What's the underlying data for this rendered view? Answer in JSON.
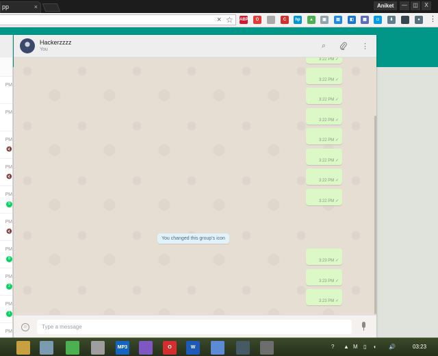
{
  "browser": {
    "tab_title": "pp",
    "tab_close": "×",
    "user_name": "Aniket",
    "window_controls": [
      "—",
      "◫",
      "X"
    ],
    "omnibox_clear": "×",
    "omnibox_star": "☆",
    "extensions": [
      {
        "name": "adblock-plus-icon",
        "label": "ABP",
        "color": "#d8152b"
      },
      {
        "name": "opera-icon",
        "label": "O",
        "color": "#e53935"
      },
      {
        "name": "grey-circle-extension-icon",
        "label": "",
        "color": "#aaaaaa"
      },
      {
        "name": "c-extension-icon",
        "label": "C",
        "color": "#d32f2f"
      },
      {
        "name": "hp-icon",
        "label": "hp",
        "color": "#0096d6"
      },
      {
        "name": "drive-icon",
        "label": "▲",
        "color": "#4caf50"
      },
      {
        "name": "image-extension-icon",
        "label": "▣",
        "color": "#90a4ae"
      },
      {
        "name": "screen-extension-icon",
        "label": "▤",
        "color": "#1e88e5"
      },
      {
        "name": "blue-tile-extension-icon",
        "label": "◧",
        "color": "#1976d2"
      },
      {
        "name": "grid-extension-icon",
        "label": "▦",
        "color": "#5c6bc0"
      },
      {
        "name": "pocket-icon",
        "label": "◘",
        "color": "#039be5"
      },
      {
        "name": "download-extension-icon",
        "label": "⬇",
        "color": "#607d8b"
      },
      {
        "name": "dark-extension-icon",
        "label": "",
        "color": "#37474f"
      },
      {
        "name": "profile-extension-icon",
        "label": "●",
        "color": "#546e7a"
      },
      {
        "name": "pinterest-icon",
        "label": "P",
        "color": "#e60023"
      }
    ],
    "menu": "⋮"
  },
  "chat_list": {
    "rows": [
      {
        "time": "PM",
        "badge": "",
        "muted": false
      },
      {
        "time": "PM",
        "badge": "",
        "muted": false
      },
      {
        "time": "PM",
        "badge": "",
        "muted": true
      },
      {
        "time": "PM",
        "badge": "",
        "muted": true
      },
      {
        "time": "PM",
        "badge": "9",
        "muted": false
      },
      {
        "time": "PM",
        "badge": "",
        "muted": true
      },
      {
        "time": "PM",
        "badge": "8",
        "muted": false
      },
      {
        "time": "PM",
        "badge": "2",
        "muted": false
      },
      {
        "time": "PM",
        "badge": "1",
        "muted": false
      },
      {
        "time": "PM",
        "badge": "",
        "muted": false
      }
    ]
  },
  "chat": {
    "name": "Hackerzzzz",
    "subtitle": "You",
    "icons": {
      "search": "⌕",
      "attach": "📎",
      "menu": "⋮"
    },
    "messages_top": [
      {
        "time": "3:22 PM",
        "tick": "✓"
      },
      {
        "time": "3:22 PM",
        "tick": "✓"
      },
      {
        "time": "3:22 PM",
        "tick": "✓"
      },
      {
        "time": "3:22 PM",
        "tick": "✓"
      },
      {
        "time": "3:22 PM",
        "tick": "✓"
      },
      {
        "time": "3:22 PM",
        "tick": "✓"
      },
      {
        "time": "3:22 PM",
        "tick": "✓"
      },
      {
        "time": "3:22 PM",
        "tick": "✓"
      }
    ],
    "system_message": "You changed this group's icon",
    "messages_bottom": [
      {
        "time": "3:23 PM",
        "tick": "✓"
      },
      {
        "time": "3:23 PM",
        "tick": "✓"
      },
      {
        "time": "3:23 PM",
        "tick": "✓"
      }
    ],
    "composer": {
      "placeholder": "Type a message",
      "emoji": "☺"
    }
  },
  "taskbar": {
    "apps": [
      {
        "name": "taskbar-app-1",
        "label": "",
        "color": "#c8a040"
      },
      {
        "name": "taskbar-app-2",
        "label": "",
        "color": "#7a9bb0"
      },
      {
        "name": "taskbar-app-3",
        "label": "",
        "color": "#4caf50"
      },
      {
        "name": "taskbar-app-4",
        "label": "",
        "color": "#9e9e9e"
      },
      {
        "name": "taskbar-app-5",
        "label": "MP3",
        "color": "#1565c0"
      },
      {
        "name": "taskbar-app-6",
        "label": "",
        "color": "#7e57c2"
      },
      {
        "name": "taskbar-app-7",
        "label": "O",
        "color": "#d32f2f"
      },
      {
        "name": "taskbar-app-8",
        "label": "W",
        "color": "#1e5bb8"
      },
      {
        "name": "taskbar-app-9",
        "label": "",
        "color": "#5c8bd6"
      },
      {
        "name": "taskbar-app-10",
        "label": "",
        "color": "#455a64"
      },
      {
        "name": "taskbar-app-11",
        "label": "",
        "color": "#6d6d6d"
      }
    ],
    "tray": [
      "?",
      "▲",
      "M",
      "▯",
      "◖",
      "🔊"
    ],
    "time": "03:23"
  }
}
